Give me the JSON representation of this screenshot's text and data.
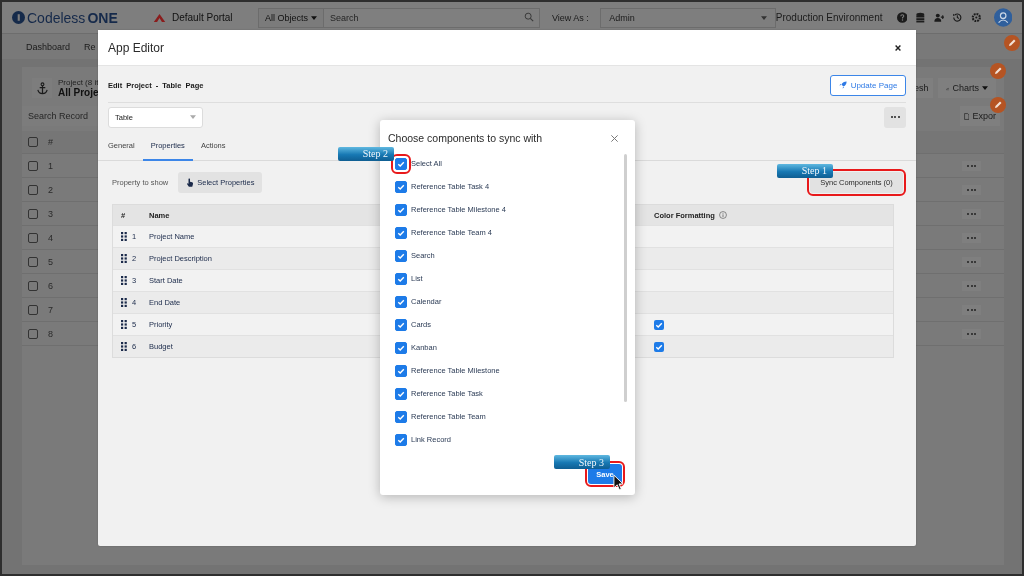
{
  "header": {
    "logo_text": "Codeless",
    "logo_suffix": "ONE",
    "portal": "Default Portal",
    "object_filter": "All Objects",
    "search": {
      "placeholder": "Search"
    },
    "view_as_label": "View As :",
    "view_as_value": "Admin",
    "environment": "Production Environment"
  },
  "nav": {
    "items": [
      "Dashboard",
      "Re"
    ]
  },
  "background_page": {
    "subtitle": "Project (8 it",
    "title": "All Proje",
    "refresh_button": "esh",
    "charts_button": "Charts",
    "search": {
      "placeholder": "Search Record"
    },
    "export_button": "Expor",
    "table": {
      "header_checked": false,
      "number_column": "#",
      "rows": [
        {
          "number": "1",
          "checked": false
        },
        {
          "number": "2",
          "checked": false
        },
        {
          "number": "3",
          "checked": false
        },
        {
          "number": "4",
          "checked": false
        },
        {
          "number": "5",
          "checked": false
        },
        {
          "number": "6",
          "checked": false
        },
        {
          "number": "7",
          "checked": false
        },
        {
          "number": "8",
          "checked": false
        }
      ]
    }
  },
  "app_editor": {
    "title": "App Editor",
    "breadcrumb": "Edit Project - Table Page",
    "update_button": "Update Page",
    "view_select": "Table",
    "tabs": [
      {
        "label": "General",
        "selected": false
      },
      {
        "label": "Properties",
        "selected": true
      },
      {
        "label": "Actions",
        "selected": false
      }
    ],
    "property_label": "Property to show",
    "select_properties_button": "Select Properties",
    "sync_button": {
      "label": "Sync Components (0)",
      "highlighted": true,
      "callout": "Step 1"
    },
    "table": {
      "columns": [
        "#",
        "Name",
        "Color Formatting"
      ],
      "rows": [
        {
          "number": "1",
          "name": "Project Name",
          "color_formatting": false
        },
        {
          "number": "2",
          "name": "Project Description",
          "color_formatting": false
        },
        {
          "number": "3",
          "name": "Start Date",
          "color_formatting": false
        },
        {
          "number": "4",
          "name": "End Date",
          "color_formatting": false
        },
        {
          "number": "5",
          "name": "Priority",
          "color_formatting": true
        },
        {
          "number": "6",
          "name": "Budget",
          "color_formatting": true
        }
      ]
    }
  },
  "sync_dialog": {
    "title": "Choose components to sync with",
    "items": [
      {
        "label": "Select All",
        "checked": true,
        "highlighted": true,
        "callout": "Step 2"
      },
      {
        "label": "Reference Table Task 4",
        "checked": true
      },
      {
        "label": "Reference Table Milestone 4",
        "checked": true
      },
      {
        "label": "Reference Table Team 4",
        "checked": true
      },
      {
        "label": "Search",
        "checked": true
      },
      {
        "label": "List",
        "checked": true
      },
      {
        "label": "Calendar",
        "checked": true
      },
      {
        "label": "Cards",
        "checked": true
      },
      {
        "label": "Kanban",
        "checked": true
      },
      {
        "label": "Reference Table Milestone",
        "checked": true
      },
      {
        "label": "Reference Table Task",
        "checked": true
      },
      {
        "label": "Reference Table Team",
        "checked": true
      },
      {
        "label": "Link Record",
        "checked": true
      }
    ],
    "save_button": {
      "label": "Save",
      "highlighted": true,
      "callout": "Step 3"
    }
  }
}
